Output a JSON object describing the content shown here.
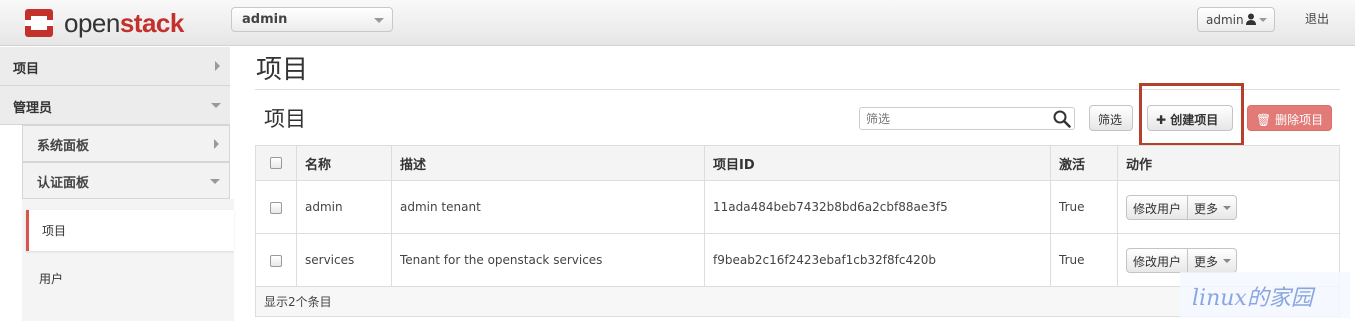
{
  "header": {
    "brand_prefix": "open",
    "brand_suffix": "stack",
    "project_select": "admin",
    "user_menu": "admin",
    "logout": "退出"
  },
  "sidebar": {
    "project": "项目",
    "admin": "管理员",
    "system_panel": "系统面板",
    "identity_panel": "认证面板",
    "projects": "项目",
    "users": "用户"
  },
  "main": {
    "page_title": "项目",
    "table_title": "项目",
    "filter_placeholder": "筛选",
    "filter_button": "筛选",
    "create_button": "创建项目",
    "delete_button": "删除项目"
  },
  "table": {
    "columns": [
      "名称",
      "描述",
      "项目ID",
      "激活",
      "动作"
    ],
    "rows": [
      {
        "name": "admin",
        "description": "admin tenant",
        "id": "11ada484beb7432b8bd6a2cbf88ae3f5",
        "enabled": "True",
        "action": "修改用户",
        "more": "更多"
      },
      {
        "name": "services",
        "description": "Tenant for the openstack services",
        "id": "f9beab2c16f2423ebaf1cb32f8fc420b",
        "enabled": "True",
        "action": "修改用户",
        "more": "更多"
      }
    ],
    "footer": "显示2个条目"
  },
  "watermark": "linux的家园",
  "colors": {
    "brand_red": "#c4302b",
    "danger": "#e27b77",
    "highlight": "#b5402b"
  }
}
